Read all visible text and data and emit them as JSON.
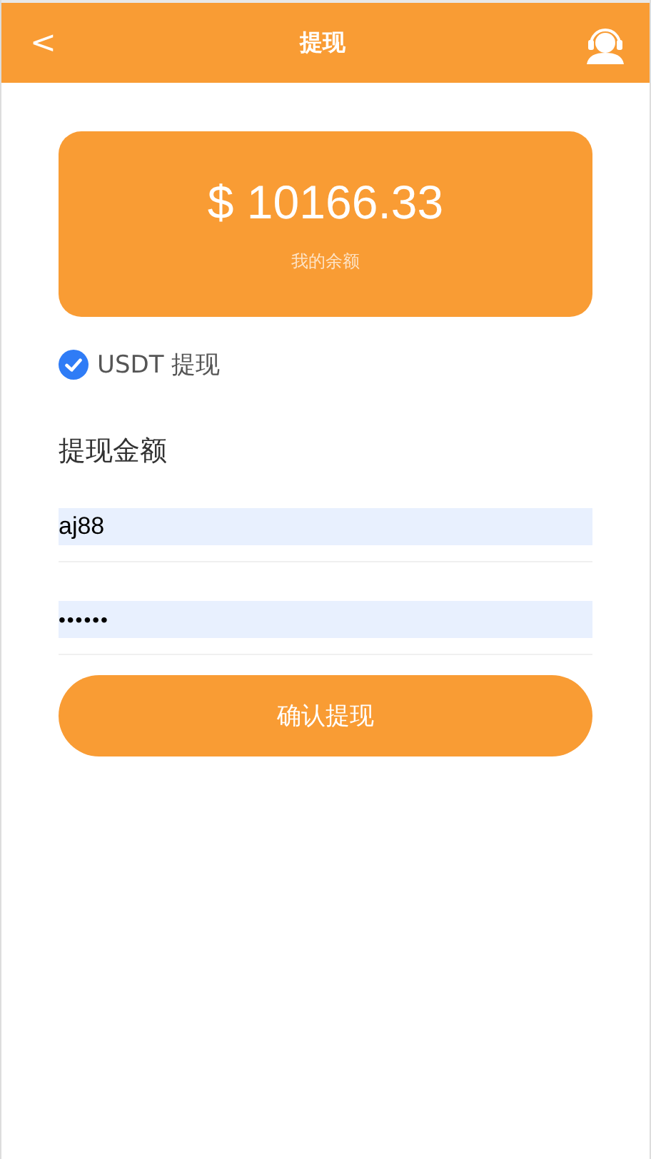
{
  "header": {
    "title": "提现",
    "back": "<"
  },
  "balance": {
    "amount": "$ 10166.33",
    "label": "我的余额"
  },
  "method": {
    "label": "USDT 提现",
    "checked": true
  },
  "section_title": "提现金额",
  "fields": [
    {
      "kind": "text",
      "value": "aj88"
    },
    {
      "kind": "password",
      "value": "••••••"
    }
  ],
  "submit": "确认提现"
}
